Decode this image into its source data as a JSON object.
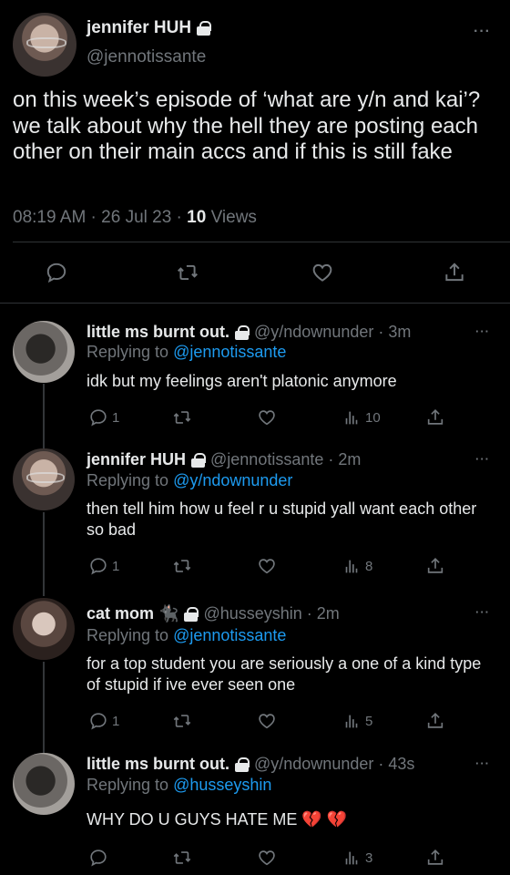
{
  "main_tweet": {
    "author_name": "jennifer HUH",
    "author_handle": "@jennotissante",
    "text": "on this week’s episode of ‘what are y/n and kai’? we talk about why the hell they are posting each other on their main accs and if this is still fake",
    "time": "08:19 AM · 26 Jul 23 · ",
    "views_count": "10",
    "views_label": " Views",
    "more": "···"
  },
  "replies": [
    {
      "name": "little ms burnt out.",
      "handle": "@y/ndownunder · 3m",
      "replying_prefix": "Replying to ",
      "replying_to": "@jennotissante",
      "text": "idk but my feelings aren't platonic anymore",
      "reply_count": "1",
      "views": "10",
      "more": "···"
    },
    {
      "name": "jennifer HUH",
      "handle": "@jennotissante · 2m",
      "replying_prefix": "Replying to ",
      "replying_to": "@y/ndownunder",
      "text": "then tell him how u feel r u stupid yall want each other so bad",
      "reply_count": "1",
      "views": "8",
      "more": "···"
    },
    {
      "name": "cat mom 🐈‍⬛",
      "handle": "@husseyshin · 2m",
      "replying_prefix": "Replying to ",
      "replying_to": "@jennotissante",
      "text": "for a top student you are seriously a one of a kind type of stupid if ive ever seen one",
      "reply_count": "1",
      "views": "5",
      "more": "···"
    },
    {
      "name": "little ms burnt out.",
      "handle": "@y/ndownunder · 43s",
      "replying_prefix": "Replying to ",
      "replying_to": "@husseyshin",
      "text": "WHY DO U GUYS HATE ME 💔 💔",
      "reply_count": "",
      "views": "3",
      "more": "···"
    }
  ],
  "colors": {
    "background": "#000000",
    "text": "#e7e9ea",
    "muted": "#71767b",
    "link": "#1d9bf0",
    "divider": "#2f3336"
  },
  "icons": [
    "reply-icon",
    "retweet-icon",
    "like-icon",
    "share-icon",
    "views-icon",
    "lock-icon",
    "more-icon"
  ]
}
